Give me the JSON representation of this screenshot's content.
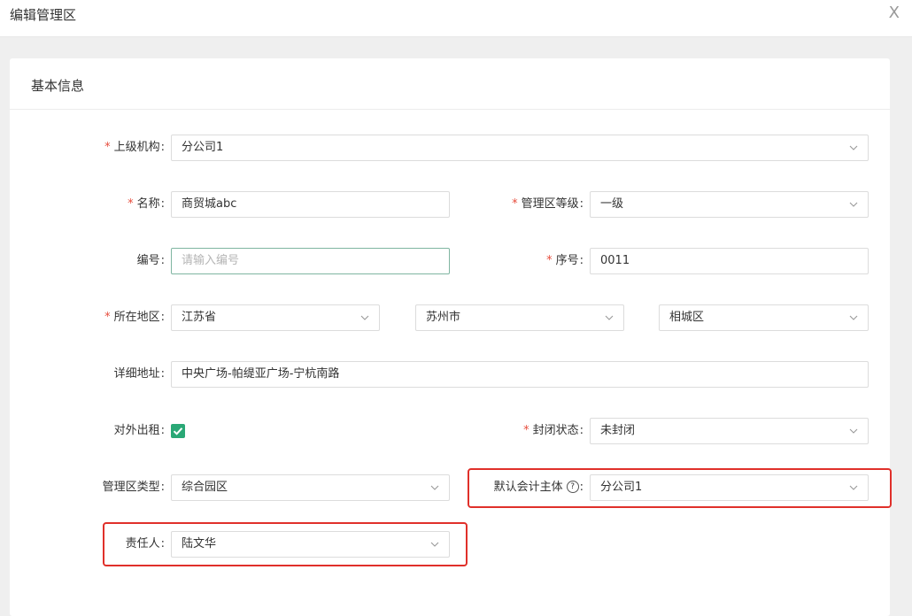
{
  "dialog": {
    "title": "编辑管理区",
    "close_symbol": "X"
  },
  "section": {
    "title": "基本信息"
  },
  "form": {
    "parent_org": {
      "label": "上级机构",
      "value": "分公司1"
    },
    "name": {
      "label": "名称",
      "value": "商贸城abc"
    },
    "level": {
      "label": "管理区等级",
      "value": "一级"
    },
    "code": {
      "label": "编号",
      "placeholder": "请输入编号"
    },
    "seq": {
      "label": "序号",
      "value": "0011"
    },
    "region": {
      "label": "所在地区",
      "province": "江苏省",
      "city": "苏州市",
      "district": "相城区"
    },
    "address": {
      "label": "详细地址",
      "value": "中央广场-帕缇亚广场-宁杭南路"
    },
    "rent_out": {
      "label": "对外出租",
      "checked": true
    },
    "closed_state": {
      "label": "封闭状态",
      "value": "未封闭"
    },
    "zone_type": {
      "label": "管理区类型",
      "value": "综合园区"
    },
    "default_entity": {
      "label": "默认会计主体",
      "help_symbol": "?",
      "value": "分公司1"
    },
    "owner": {
      "label": "责任人",
      "value": "陆文华"
    }
  },
  "colors": {
    "required": "#e74c3c",
    "checkbox": "#2aa876",
    "highlight": "#e0302a",
    "focus_border": "#7fb5a1"
  },
  "icons": {
    "dropdown": "chevron-down-icon",
    "check": "check-icon",
    "help": "question-circle-icon",
    "close": "close-icon"
  }
}
